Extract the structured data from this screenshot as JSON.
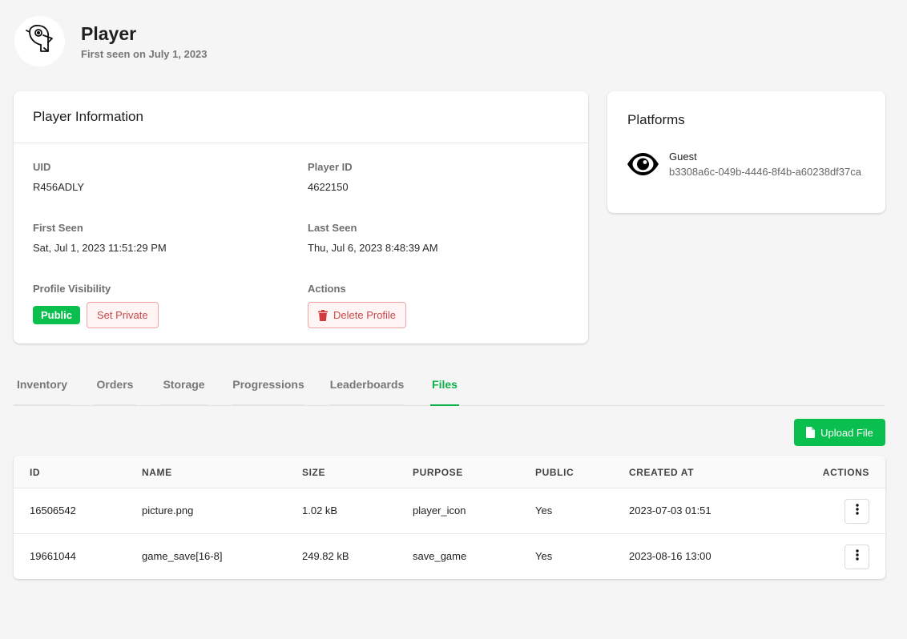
{
  "header": {
    "title": "Player",
    "subtitle": "First seen on July 1, 2023",
    "avatar_icon": "parrot-icon"
  },
  "info": {
    "title": "Player Information",
    "uid_label": "UID",
    "uid_value": "R456ADLY",
    "player_id_label": "Player ID",
    "player_id_value": "4622150",
    "first_seen_label": "First Seen",
    "first_seen_value": "Sat, Jul 1, 2023 11:51:29 PM",
    "last_seen_label": "Last Seen",
    "last_seen_value": "Thu, Jul 6, 2023 8:48:39 AM",
    "visibility_label": "Profile Visibility",
    "visibility_badge": "Public",
    "set_private_label": "Set Private",
    "actions_label": "Actions",
    "delete_label": "Delete Profile"
  },
  "platforms": {
    "title": "Platforms",
    "items": [
      {
        "name": "Guest",
        "id": "b3308a6c-049b-4446-8f4b-a60238df37ca",
        "icon": "eye-icon"
      }
    ]
  },
  "tabs": [
    {
      "label": "Inventory",
      "active": false
    },
    {
      "label": "Orders",
      "active": false
    },
    {
      "label": "Storage",
      "active": false
    },
    {
      "label": "Progressions",
      "active": false
    },
    {
      "label": "Leaderboards",
      "active": false
    },
    {
      "label": "Files",
      "active": true
    }
  ],
  "upload": {
    "label": "Upload File",
    "icon": "file-icon"
  },
  "table": {
    "columns": [
      "ID",
      "NAME",
      "SIZE",
      "PURPOSE",
      "PUBLIC",
      "CREATED AT",
      "ACTIONS"
    ],
    "rows": [
      {
        "id": "16506542",
        "name": "picture.png",
        "size": "1.02 kB",
        "purpose": "player_icon",
        "public": "Yes",
        "created": "2023-07-03 01:51"
      },
      {
        "id": "19661044",
        "name": "game_save[16-8]",
        "size": "249.82 kB",
        "purpose": "save_game",
        "public": "Yes",
        "created": "2023-08-16 13:00"
      }
    ]
  },
  "colors": {
    "accent": "#0bbf4e",
    "danger": "#c9494b",
    "background": "#f5f5f5"
  }
}
